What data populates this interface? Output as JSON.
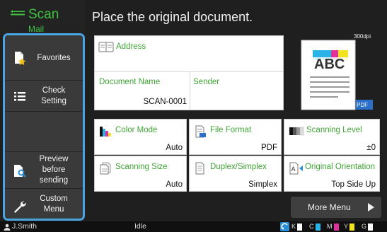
{
  "app": {
    "title": "Scan",
    "subtitle": "Mail"
  },
  "header": {
    "message": "Place the original document."
  },
  "sidebar": {
    "items": [
      {
        "label": "Favorites",
        "icon": "favorites-icon"
      },
      {
        "label": "Check Setting",
        "icon": "list-icon"
      },
      {
        "label": "Preview before sending",
        "icon": "preview-icon"
      },
      {
        "label": "Custom Menu",
        "icon": "wrench-icon"
      }
    ]
  },
  "document": {
    "address_label": "Address",
    "document_name_label": "Document Name",
    "document_name_value": "SCAN-0001",
    "sender_label": "Sender"
  },
  "settings": {
    "color_mode": {
      "label": "Color Mode",
      "value": "Auto"
    },
    "file_format": {
      "label": "File Format",
      "value": "PDF"
    },
    "scanning_level": {
      "label": "Scanning Level",
      "value": "±0"
    },
    "scanning_size": {
      "label": "Scanning Size",
      "value": "Auto"
    },
    "duplex_simplex": {
      "label": "Duplex/Simplex",
      "value": "Simplex"
    },
    "original_orientation": {
      "label": "Original Orientation",
      "value": "Top Side Up"
    }
  },
  "preview": {
    "resolution": "300dpi",
    "sample_text": "ABC",
    "format_badge": "PDF"
  },
  "more_menu": {
    "label": "More Menu"
  },
  "status_bar": {
    "user": "J.Smith",
    "state": "Idle",
    "toner": [
      {
        "label": "K",
        "color": "#ffffff"
      },
      {
        "label": "C",
        "color": "#29b3e6"
      },
      {
        "label": "M",
        "color": "#e0309a"
      },
      {
        "label": "Y",
        "color": "#f2e21f"
      },
      {
        "label": "G",
        "color": "#ffffff"
      }
    ]
  },
  "colors": {
    "accent": "#3fa535",
    "selection": "#4aa6e3",
    "background": "#1f1f1f"
  }
}
